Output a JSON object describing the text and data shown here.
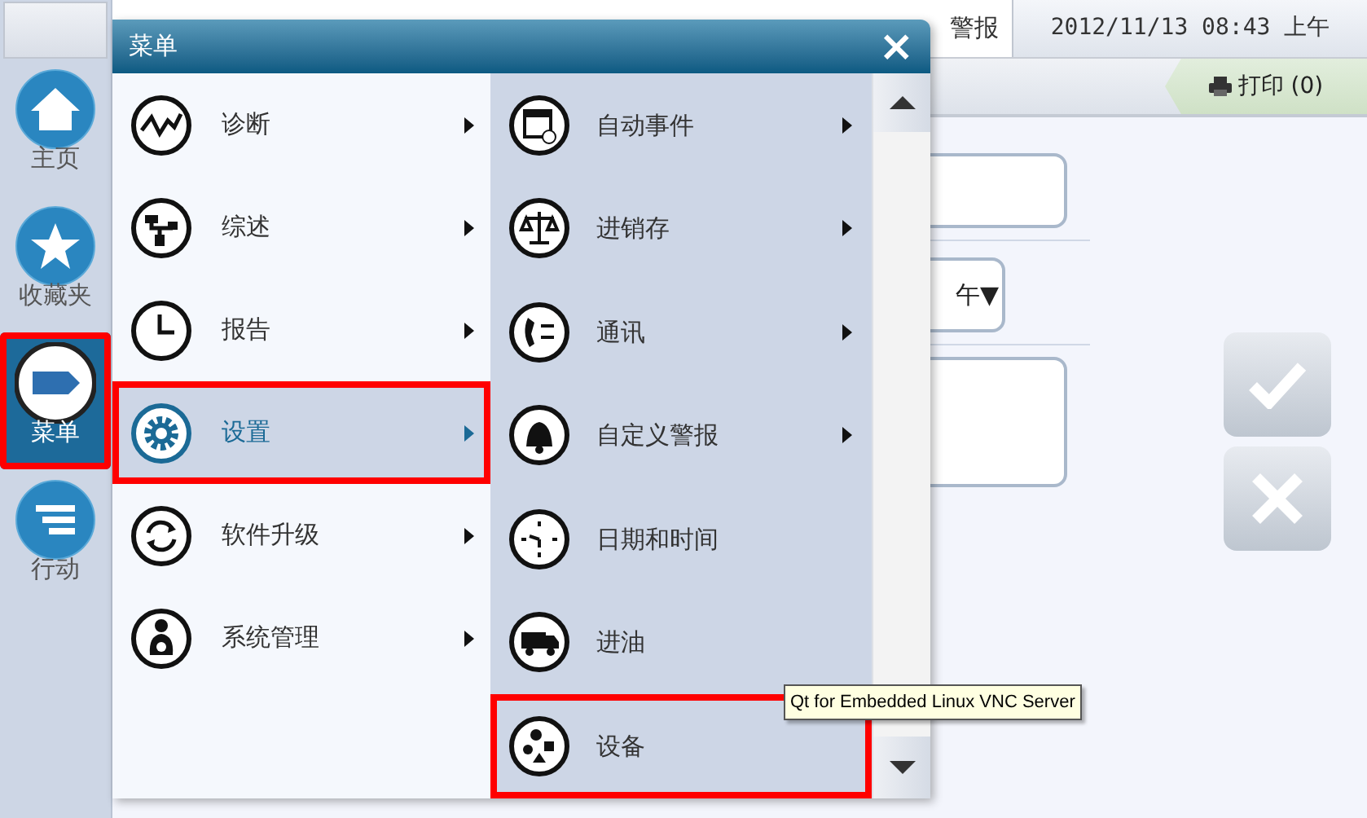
{
  "sidebar": {
    "items": [
      {
        "label": "主页",
        "selected": false,
        "highlighted": false
      },
      {
        "label": "收藏夹",
        "selected": false,
        "highlighted": false
      },
      {
        "label": "菜单",
        "selected": true,
        "highlighted": true
      },
      {
        "label": "行动",
        "selected": false,
        "highlighted": false
      }
    ]
  },
  "top_bar": {
    "tabs": [
      {
        "label": "警报"
      },
      {
        "label": "2012/11/13 08:43 上午"
      }
    ],
    "print_button": "打印 (0)"
  },
  "form": {
    "dropdown_value": "午▼"
  },
  "menu": {
    "title": "菜单",
    "close": "×",
    "left_items": [
      {
        "label": "诊断",
        "selected": false,
        "highlighted": false,
        "has_submenu": true
      },
      {
        "label": "综述",
        "selected": false,
        "highlighted": false,
        "has_submenu": true
      },
      {
        "label": "报告",
        "selected": false,
        "highlighted": false,
        "has_submenu": true
      },
      {
        "label": "设置",
        "selected": true,
        "highlighted": true,
        "has_submenu": true
      },
      {
        "label": "软件升级",
        "selected": false,
        "highlighted": false,
        "has_submenu": true
      },
      {
        "label": "系统管理",
        "selected": false,
        "highlighted": false,
        "has_submenu": true
      }
    ],
    "right_items": [
      {
        "label": "自动事件",
        "highlighted": false,
        "has_submenu": true
      },
      {
        "label": "进销存",
        "highlighted": false,
        "has_submenu": true
      },
      {
        "label": "通讯",
        "highlighted": false,
        "has_submenu": true
      },
      {
        "label": "自定义警报",
        "highlighted": false,
        "has_submenu": true
      },
      {
        "label": "日期和时间",
        "highlighted": false,
        "has_submenu": false
      },
      {
        "label": "进油",
        "highlighted": false,
        "has_submenu": false
      },
      {
        "label": "设备",
        "highlighted": true,
        "has_submenu": false
      }
    ]
  },
  "tooltip": "Qt for Embedded Linux VNC Server"
}
